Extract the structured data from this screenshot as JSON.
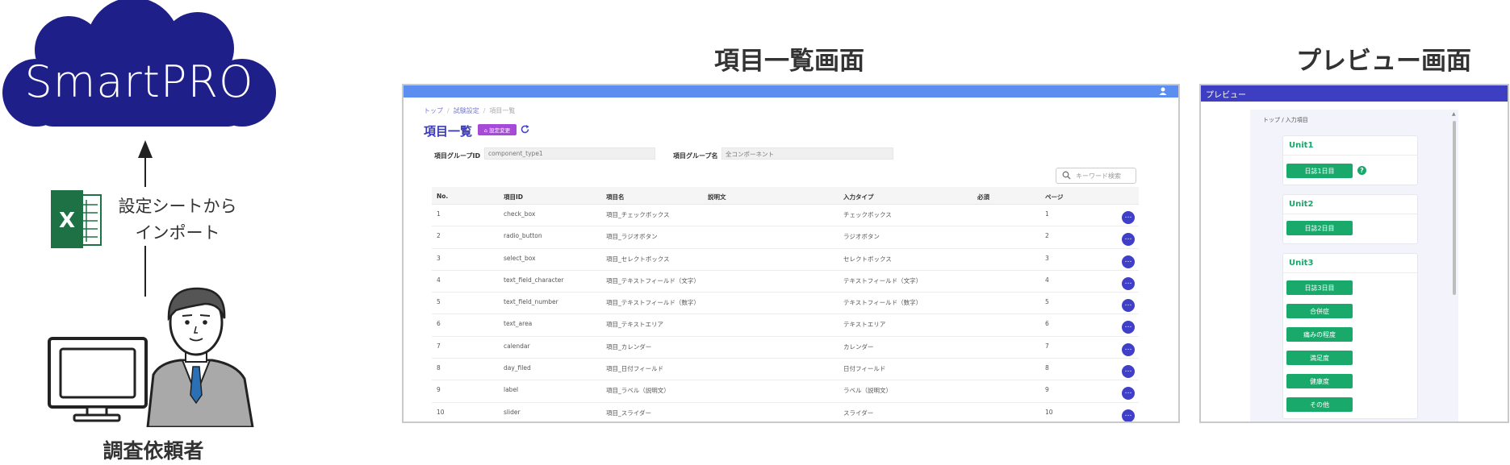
{
  "diagram": {
    "cloud_label": "SmartPRO",
    "import_label_line1": "設定シートから",
    "import_label_line2": "インポート",
    "requester_label": "調査依頼者",
    "list_screen_title": "項目一覧画面",
    "preview_screen_title": "プレビュー画面",
    "colors": {
      "cloud": "#1f1f8a",
      "excel": "#1e7145",
      "list_topbar": "#5b8ef0",
      "preview_topbar": "#3e3ec2",
      "green": "#18a96b"
    }
  },
  "list_screen": {
    "breadcrumb": [
      "トップ",
      "試験設定",
      "項目一覧"
    ],
    "title": "項目一覧",
    "setting_button": "⌂ 設定変更",
    "group_id_label": "項目グループID",
    "group_id_value": "component_type1",
    "group_name_label": "項目グループ名",
    "group_name_value": "全コンポーネント",
    "search_placeholder": "キーワード検索",
    "columns": [
      "No.",
      "項目ID",
      "項目名",
      "説明文",
      "入力タイプ",
      "必須",
      "ページ"
    ],
    "rows": [
      {
        "no": "1",
        "id": "check_box",
        "name": "項目_チェックボックス",
        "type": "チェックボックス",
        "page": "1"
      },
      {
        "no": "2",
        "id": "radio_button",
        "name": "項目_ラジオボタン",
        "type": "ラジオボタン",
        "page": "2"
      },
      {
        "no": "3",
        "id": "select_box",
        "name": "項目_セレクトボックス",
        "type": "セレクトボックス",
        "page": "3"
      },
      {
        "no": "4",
        "id": "text_field_character",
        "name": "項目_テキストフィールド（文字）",
        "type": "テキストフィールド（文字）",
        "page": "4"
      },
      {
        "no": "5",
        "id": "text_field_number",
        "name": "項目_テキストフィールド（数字）",
        "type": "テキストフィールド（数字）",
        "page": "5"
      },
      {
        "no": "6",
        "id": "text_area",
        "name": "項目_テキストエリア",
        "type": "テキストエリア",
        "page": "6"
      },
      {
        "no": "7",
        "id": "calendar",
        "name": "項目_カレンダー",
        "type": "カレンダー",
        "page": "7"
      },
      {
        "no": "8",
        "id": "day_filed",
        "name": "項目_日付フィールド",
        "type": "日付フィールド",
        "page": "8"
      },
      {
        "no": "9",
        "id": "label",
        "name": "項目_ラベル（説明文）",
        "type": "ラベル（説明文）",
        "page": "9"
      },
      {
        "no": "10",
        "id": "slider",
        "name": "項目_スライダー",
        "type": "スライダー",
        "page": "10"
      }
    ],
    "more_button": "…"
  },
  "preview_screen": {
    "topbar_title": "プレビュー",
    "breadcrumb": "トップ / 入力項目",
    "units": [
      {
        "title": "Unit1",
        "buttons": [
          "日誌1日目"
        ],
        "help": "?"
      },
      {
        "title": "Unit2",
        "buttons": [
          "日誌2日目"
        ]
      },
      {
        "title": "Unit3",
        "buttons": [
          "日誌3日目",
          "合併症",
          "痛みの程度",
          "満足度",
          "健康度",
          "その他"
        ]
      }
    ]
  }
}
